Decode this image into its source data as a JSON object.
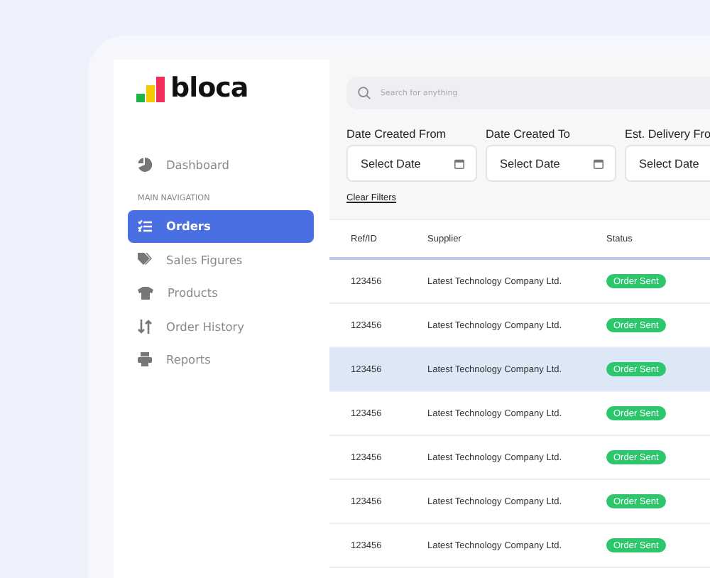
{
  "sidebar": {
    "logo": "bloca",
    "top_items": [
      {
        "label": "Dashboard",
        "selected": false
      }
    ],
    "section_title": "MAIN NAVIGATION",
    "items": [
      {
        "label": "Orders",
        "selected": true
      },
      {
        "label": "Sales Figures",
        "selected": false
      },
      {
        "label": "Products",
        "selected": false
      },
      {
        "label": "Order History",
        "selected": false
      },
      {
        "label": "Reports",
        "selected": false
      }
    ]
  },
  "search": {
    "placeholder": "Search for anything"
  },
  "filters": [
    {
      "label": "Date Created From",
      "placeholder": "Select Date"
    },
    {
      "label": "Date Created To",
      "placeholder": "Select Date"
    },
    {
      "label": "Est. Delivery Fro",
      "placeholder": "Select Date"
    }
  ],
  "clear_filters": "Clear Filters",
  "table": {
    "columns": [
      "Ref/ID",
      "Supplier",
      "Status"
    ],
    "rows": [
      {
        "ref": "123456",
        "supplier": "Latest Technology Company Ltd.",
        "status": "Order Sent",
        "selected": false
      },
      {
        "ref": "123456",
        "supplier": "Latest Technology Company Ltd.",
        "status": "Order Sent",
        "selected": false
      },
      {
        "ref": "123456",
        "supplier": "Latest Technology Company Ltd.",
        "status": "Order Sent",
        "selected": true
      },
      {
        "ref": "123456",
        "supplier": "Latest Technology Company Ltd.",
        "status": "Order Sent",
        "selected": false
      },
      {
        "ref": "123456",
        "supplier": "Latest Technology Company Ltd.",
        "status": "Order Sent",
        "selected": false
      },
      {
        "ref": "123456",
        "supplier": "Latest Technology Company Ltd.",
        "status": "Order Sent",
        "selected": false
      },
      {
        "ref": "123456",
        "supplier": "Latest Technology Company Ltd.",
        "status": "Order Sent",
        "selected": false
      }
    ]
  }
}
